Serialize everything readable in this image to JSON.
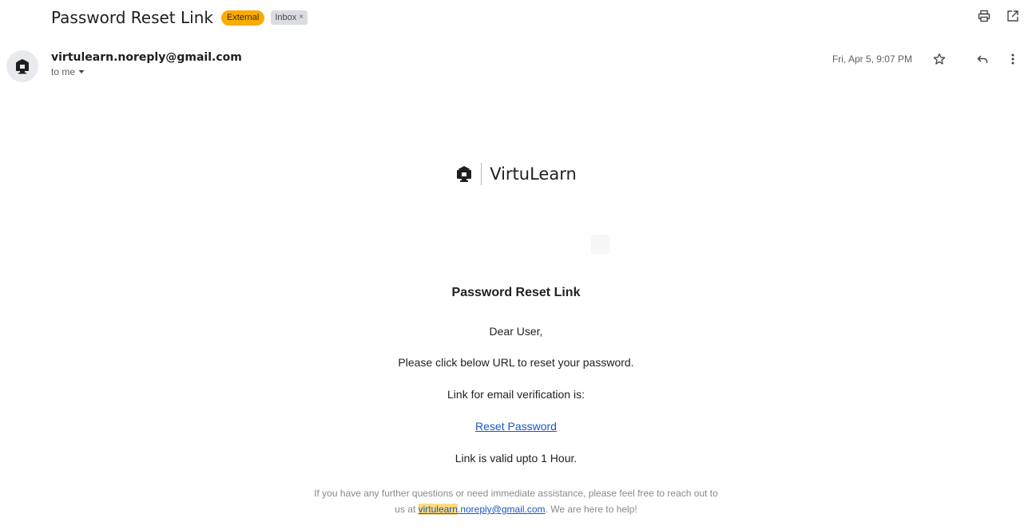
{
  "email": {
    "subject": "Password Reset Link",
    "labels": {
      "external": "External",
      "inbox": "Inbox"
    },
    "sender": "virtulearn.noreply@gmail.com",
    "recipient": "to me",
    "date": "Fri, Apr 5, 9:07 PM"
  },
  "icons": [
    "print-icon",
    "open-new-window-icon",
    "star-icon",
    "reply-icon",
    "more-vert-icon",
    "avatar-icon",
    "chevron-down-icon",
    "virtulearn-logo-icon"
  ],
  "content": {
    "brand": "VirtuLearn",
    "heading": "Password Reset Link",
    "greeting": "Dear User,",
    "instruction": "Please click below URL to reset your password.",
    "link_intro": "Link for email verification is:",
    "reset_link": "Reset Password",
    "validity": "Link is valid upto 1 Hour.",
    "footer_line1": "If you have any further questions or need immediate assistance, please feel free to reach out to",
    "footer_prefix": "us at",
    "footer_email_highlight": "virtulearn",
    "footer_email_rest": ".noreply@gmail.com",
    "footer_suffix": ". We are here to help!"
  },
  "colors": {
    "external_badge": "#f9ab00",
    "link": "#1a55c4",
    "highlight": "#fddc7a"
  }
}
